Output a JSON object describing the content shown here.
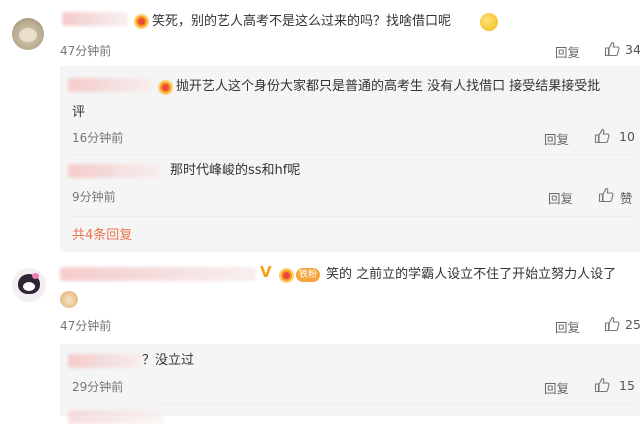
{
  "labels": {
    "reply": "回复",
    "like": "赞"
  },
  "comments": [
    {
      "text": "笑死，别的艺人高考不是这么过来的吗？找啥借口呢",
      "time": "47分钟前",
      "likes": "34",
      "replies": [
        {
          "text": "抛开艺人这个身份大家都只是普通的高考生 没有人找借口 接受结果接受批",
          "text_cont": "评",
          "time": "16分钟前",
          "likes": "10"
        },
        {
          "text": "那时代峰峻的ss和hf呢",
          "time": "9分钟前"
        }
      ],
      "more_replies": "共4条回复"
    },
    {
      "vip": "V",
      "fan_tag": "铁粉",
      "text": "笑的 之前立的学霸人设立不住了开始立努力人设了",
      "time": "47分钟前",
      "likes": "25",
      "replies": [
        {
          "text": "？没立过",
          "time": "29分钟前",
          "likes": "15"
        }
      ]
    }
  ]
}
